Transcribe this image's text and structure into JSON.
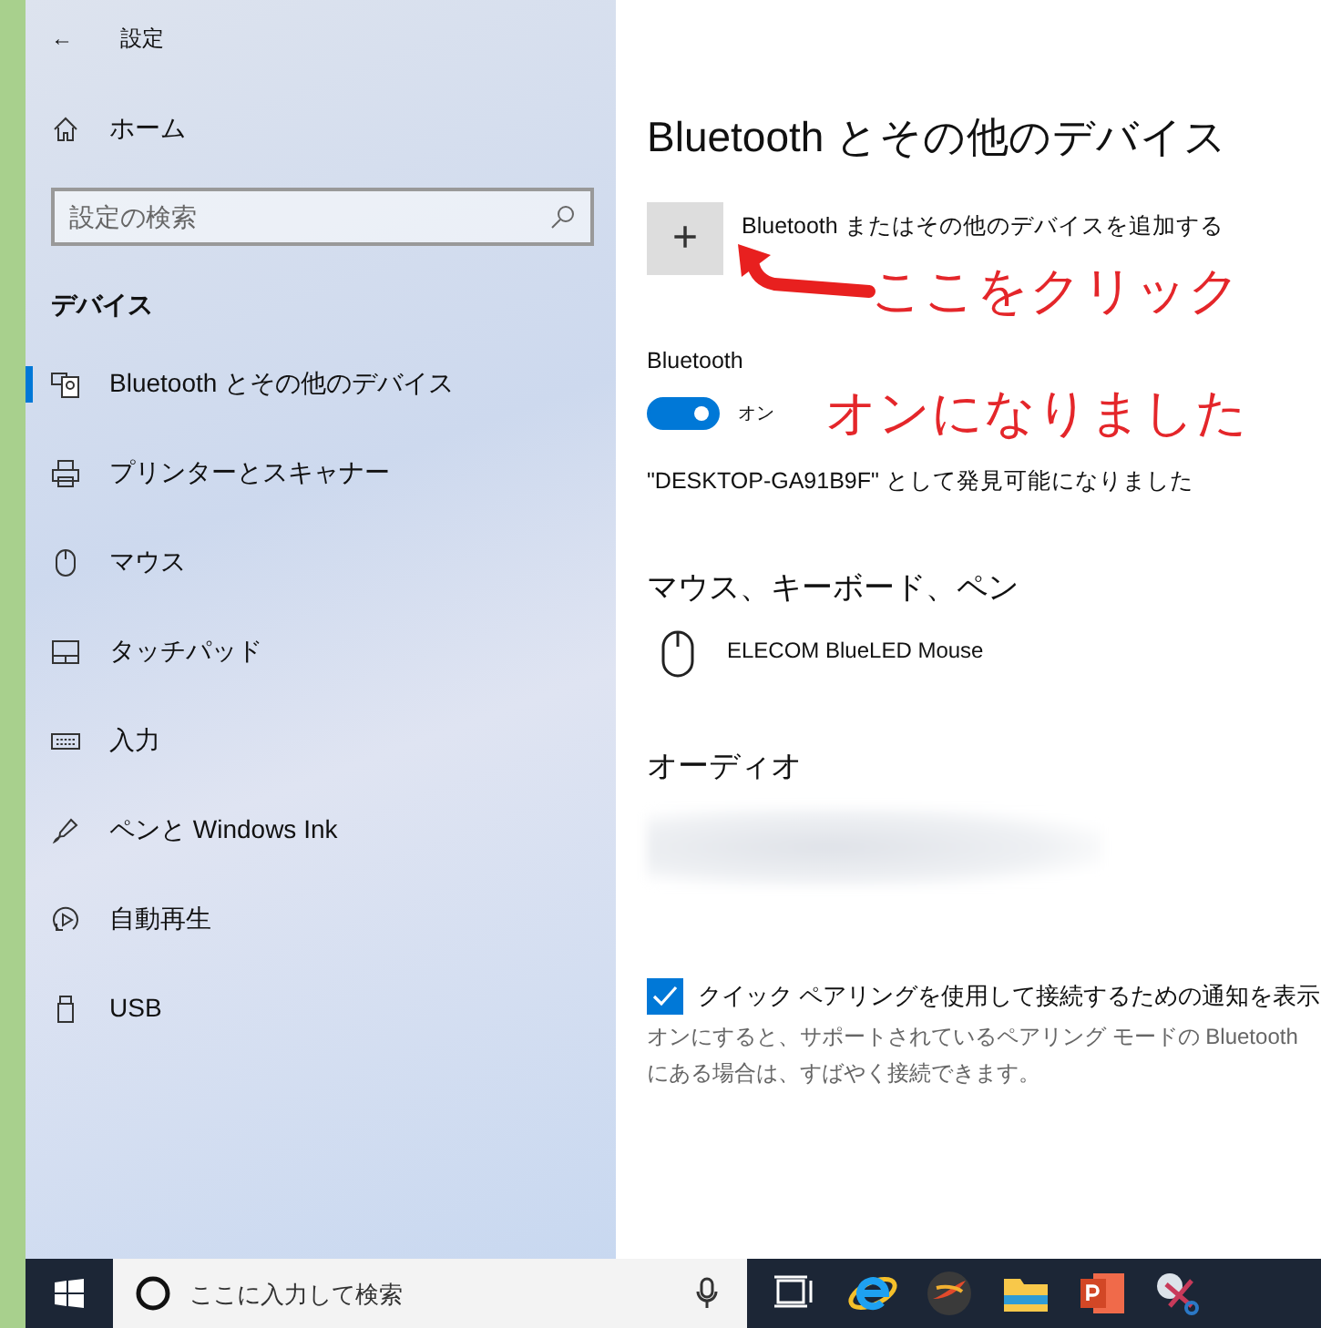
{
  "window": {
    "title": "設定",
    "back": "←"
  },
  "sidebar": {
    "home": "ホーム",
    "search": {
      "placeholder": "設定の検索"
    },
    "section": "デバイス",
    "items": [
      {
        "label": "Bluetooth とその他のデバイス",
        "kind": "bluetooth",
        "selected": true
      },
      {
        "label": "プリンターとスキャナー",
        "kind": "printer",
        "selected": false
      },
      {
        "label": "マウス",
        "kind": "mouse",
        "selected": false
      },
      {
        "label": "タッチパッド",
        "kind": "touchpad",
        "selected": false
      },
      {
        "label": "入力",
        "kind": "keyboard",
        "selected": false
      },
      {
        "label": "ペンと Windows Ink",
        "kind": "pen",
        "selected": false
      },
      {
        "label": "自動再生",
        "kind": "autoplay",
        "selected": false
      },
      {
        "label": "USB",
        "kind": "usb",
        "selected": false
      }
    ]
  },
  "main": {
    "title": "Bluetooth とその他のデバイス",
    "add": {
      "symbol": "+",
      "label": "Bluetooth またはその他のデバイスを追加する"
    },
    "bluetooth": {
      "label": "Bluetooth",
      "on": true,
      "state_text": "オン"
    },
    "discoverable": "\"DESKTOP-GA91B9F\" として発見可能になりました",
    "sections": [
      {
        "heading": "マウス、キーボード、ペン",
        "devices": [
          {
            "name": "ELECOM BlueLED Mouse",
            "kind": "mouse"
          }
        ]
      },
      {
        "heading": "オーディオ",
        "devices": [
          {
            "kind": "redacted"
          }
        ]
      }
    ],
    "quick_pair": {
      "label": "クイック ペアリングを使用して接続するための通知を表示",
      "checked": true,
      "description": [
        "オンにすると、サポートされているペアリング モードの Bluetooth",
        "にある場合は、すばやく接続できます。"
      ]
    }
  },
  "annotations": [
    {
      "text": "ここをクリック"
    },
    {
      "text": "オンになりました"
    }
  ],
  "taskbar": {
    "search": {
      "placeholder": "ここに入力して検索"
    },
    "apps": [
      {
        "kind": "taskview"
      },
      {
        "kind": "browser"
      },
      {
        "kind": "orb"
      },
      {
        "kind": "folder"
      },
      {
        "kind": "slides"
      },
      {
        "kind": "snip"
      }
    ]
  }
}
